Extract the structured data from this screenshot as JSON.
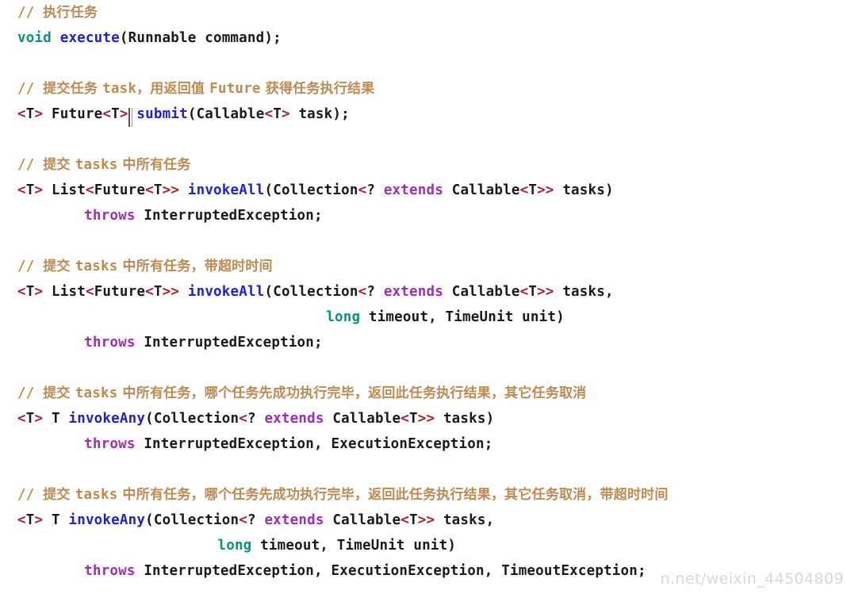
{
  "editor": {
    "background": "#ffffff",
    "language": "java",
    "colors": {
      "comment": "#bd8a54",
      "keyword": "#0f9177",
      "method": "#2222cc",
      "modifier": "#9b2fb4",
      "generic_bracket": "#a5212b",
      "plain_text": "#1a1a1a",
      "watermark": "#d8d8d8"
    }
  },
  "watermark": {
    "text": "n.net/weixin_44504809"
  },
  "code": {
    "lines": [
      {
        "id": "line-1-comment-execute",
        "indent": 0,
        "tokens": [
          {
            "kind": "comment",
            "text": "// "
          },
          {
            "kind": "comment",
            "cjk": true,
            "text": "执行任务"
          }
        ]
      },
      {
        "id": "line-2-execute-signature",
        "indent": 0,
        "tokens": [
          {
            "kind": "keyword",
            "text": "void"
          },
          {
            "kind": "plain",
            "text": " "
          },
          {
            "kind": "method",
            "text": "execute"
          },
          {
            "kind": "plain",
            "text": "(Runnable command);"
          }
        ]
      },
      {
        "id": "line-3-blank",
        "blank": true,
        "tokens": []
      },
      {
        "id": "line-4-comment-submit",
        "indent": 0,
        "tokens": [
          {
            "kind": "comment",
            "text": "// "
          },
          {
            "kind": "comment",
            "cjk": true,
            "text": "提交任务 "
          },
          {
            "kind": "comment",
            "text": "task"
          },
          {
            "kind": "comment",
            "cjk": true,
            "text": "，用返回值 "
          },
          {
            "kind": "comment",
            "text": "Future"
          },
          {
            "kind": "comment",
            "cjk": true,
            "text": " 获得任务执行结果"
          }
        ]
      },
      {
        "id": "line-5-submit-signature",
        "indent": 0,
        "tokens": [
          {
            "kind": "generic",
            "text": "<"
          },
          {
            "kind": "plain",
            "text": "T"
          },
          {
            "kind": "generic",
            "text": ">"
          },
          {
            "kind": "plain",
            "text": " Future"
          },
          {
            "kind": "generic",
            "text": "<"
          },
          {
            "kind": "plain",
            "text": "T"
          },
          {
            "kind": "generic",
            "text": ">"
          },
          {
            "kind": "caret",
            "text": ""
          },
          {
            "kind": "plain",
            "text": " "
          },
          {
            "kind": "method",
            "text": "submit"
          },
          {
            "kind": "plain",
            "text": "(Callable"
          },
          {
            "kind": "generic",
            "text": "<"
          },
          {
            "kind": "plain",
            "text": "T"
          },
          {
            "kind": "generic",
            "text": ">"
          },
          {
            "kind": "plain",
            "text": " task);"
          }
        ]
      },
      {
        "id": "line-6-blank",
        "blank": true,
        "tokens": []
      },
      {
        "id": "line-7-comment-invokeall",
        "indent": 0,
        "tokens": [
          {
            "kind": "comment",
            "text": "// "
          },
          {
            "kind": "comment",
            "cjk": true,
            "text": "提交 "
          },
          {
            "kind": "comment",
            "text": "tasks"
          },
          {
            "kind": "comment",
            "cjk": true,
            "text": " 中所有任务"
          }
        ]
      },
      {
        "id": "line-8-invokeall-signature",
        "indent": 0,
        "tokens": [
          {
            "kind": "generic",
            "text": "<"
          },
          {
            "kind": "plain",
            "text": "T"
          },
          {
            "kind": "generic",
            "text": ">"
          },
          {
            "kind": "plain",
            "text": " List"
          },
          {
            "kind": "generic",
            "text": "<"
          },
          {
            "kind": "plain",
            "text": "Future"
          },
          {
            "kind": "generic",
            "text": "<"
          },
          {
            "kind": "plain",
            "text": "T"
          },
          {
            "kind": "generic",
            "text": ">>"
          },
          {
            "kind": "plain",
            "text": " "
          },
          {
            "kind": "method",
            "text": "invokeAll"
          },
          {
            "kind": "plain",
            "text": "(Collection"
          },
          {
            "kind": "generic",
            "text": "<"
          },
          {
            "kind": "plain",
            "text": "? "
          },
          {
            "kind": "modifier",
            "text": "extends"
          },
          {
            "kind": "plain",
            "text": " Callable"
          },
          {
            "kind": "generic",
            "text": "<"
          },
          {
            "kind": "plain",
            "text": "T"
          },
          {
            "kind": "generic",
            "text": ">>"
          },
          {
            "kind": "plain",
            "text": " tasks)"
          }
        ]
      },
      {
        "id": "line-9-invokeall-throws",
        "indent": 8,
        "tokens": [
          {
            "kind": "modifier",
            "text": "throws"
          },
          {
            "kind": "plain",
            "text": " InterruptedException;"
          }
        ]
      },
      {
        "id": "line-10-blank",
        "blank": true,
        "tokens": []
      },
      {
        "id": "line-11-comment-invokeall-timeout",
        "indent": 0,
        "tokens": [
          {
            "kind": "comment",
            "text": "// "
          },
          {
            "kind": "comment",
            "cjk": true,
            "text": "提交 "
          },
          {
            "kind": "comment",
            "text": "tasks"
          },
          {
            "kind": "comment",
            "cjk": true,
            "text": " 中所有任务，带超时时间"
          }
        ]
      },
      {
        "id": "line-12-invokeall-timeout-signature",
        "indent": 0,
        "tokens": [
          {
            "kind": "generic",
            "text": "<"
          },
          {
            "kind": "plain",
            "text": "T"
          },
          {
            "kind": "generic",
            "text": ">"
          },
          {
            "kind": "plain",
            "text": " List"
          },
          {
            "kind": "generic",
            "text": "<"
          },
          {
            "kind": "plain",
            "text": "Future"
          },
          {
            "kind": "generic",
            "text": "<"
          },
          {
            "kind": "plain",
            "text": "T"
          },
          {
            "kind": "generic",
            "text": ">>"
          },
          {
            "kind": "plain",
            "text": " "
          },
          {
            "kind": "method",
            "text": "invokeAll"
          },
          {
            "kind": "plain",
            "text": "(Collection"
          },
          {
            "kind": "generic",
            "text": "<"
          },
          {
            "kind": "plain",
            "text": "? "
          },
          {
            "kind": "modifier",
            "text": "extends"
          },
          {
            "kind": "plain",
            "text": " Callable"
          },
          {
            "kind": "generic",
            "text": "<"
          },
          {
            "kind": "plain",
            "text": "T"
          },
          {
            "kind": "generic",
            "text": ">>"
          },
          {
            "kind": "plain",
            "text": " tasks,"
          }
        ]
      },
      {
        "id": "line-13-invokeall-timeout-params",
        "indent": 37,
        "tokens": [
          {
            "kind": "keyword",
            "text": "long"
          },
          {
            "kind": "plain",
            "text": " timeout, TimeUnit unit)"
          }
        ]
      },
      {
        "id": "line-14-invokeall-timeout-throws",
        "indent": 8,
        "tokens": [
          {
            "kind": "modifier",
            "text": "throws"
          },
          {
            "kind": "plain",
            "text": " InterruptedException;"
          }
        ]
      },
      {
        "id": "line-15-blank",
        "blank": true,
        "tokens": []
      },
      {
        "id": "line-16-comment-invokeany",
        "indent": 0,
        "tokens": [
          {
            "kind": "comment",
            "text": "// "
          },
          {
            "kind": "comment",
            "cjk": true,
            "text": "提交 "
          },
          {
            "kind": "comment",
            "text": "tasks"
          },
          {
            "kind": "comment",
            "cjk": true,
            "text": " 中所有任务，哪个任务先成功执行完毕，返回此任务执行结果，其它任务取消"
          }
        ]
      },
      {
        "id": "line-17-invokeany-signature",
        "indent": 0,
        "tokens": [
          {
            "kind": "generic",
            "text": "<"
          },
          {
            "kind": "plain",
            "text": "T"
          },
          {
            "kind": "generic",
            "text": ">"
          },
          {
            "kind": "plain",
            "text": " T "
          },
          {
            "kind": "method",
            "text": "invokeAny"
          },
          {
            "kind": "plain",
            "text": "(Collection"
          },
          {
            "kind": "generic",
            "text": "<"
          },
          {
            "kind": "plain",
            "text": "? "
          },
          {
            "kind": "modifier",
            "text": "extends"
          },
          {
            "kind": "plain",
            "text": " Callable"
          },
          {
            "kind": "generic",
            "text": "<"
          },
          {
            "kind": "plain",
            "text": "T"
          },
          {
            "kind": "generic",
            "text": ">>"
          },
          {
            "kind": "plain",
            "text": " tasks)"
          }
        ]
      },
      {
        "id": "line-18-invokeany-throws",
        "indent": 8,
        "tokens": [
          {
            "kind": "modifier",
            "text": "throws"
          },
          {
            "kind": "plain",
            "text": " InterruptedException, ExecutionException;"
          }
        ]
      },
      {
        "id": "line-19-blank",
        "blank": true,
        "tokens": []
      },
      {
        "id": "line-20-comment-invokeany-timeout",
        "indent": 0,
        "tokens": [
          {
            "kind": "comment",
            "text": "// "
          },
          {
            "kind": "comment",
            "cjk": true,
            "text": "提交 "
          },
          {
            "kind": "comment",
            "text": "tasks"
          },
          {
            "kind": "comment",
            "cjk": true,
            "text": " 中所有任务，哪个任务先成功执行完毕，返回此任务执行结果，其它任务取消，带超时时间"
          }
        ]
      },
      {
        "id": "line-21-invokeany-timeout-signature",
        "indent": 0,
        "tokens": [
          {
            "kind": "generic",
            "text": "<"
          },
          {
            "kind": "plain",
            "text": "T"
          },
          {
            "kind": "generic",
            "text": ">"
          },
          {
            "kind": "plain",
            "text": " T "
          },
          {
            "kind": "method",
            "text": "invokeAny"
          },
          {
            "kind": "plain",
            "text": "(Collection"
          },
          {
            "kind": "generic",
            "text": "<"
          },
          {
            "kind": "plain",
            "text": "? "
          },
          {
            "kind": "modifier",
            "text": "extends"
          },
          {
            "kind": "plain",
            "text": " Callable"
          },
          {
            "kind": "generic",
            "text": "<"
          },
          {
            "kind": "plain",
            "text": "T"
          },
          {
            "kind": "generic",
            "text": ">>"
          },
          {
            "kind": "plain",
            "text": " tasks,"
          }
        ]
      },
      {
        "id": "line-22-invokeany-timeout-params",
        "indent": 24,
        "tokens": [
          {
            "kind": "keyword",
            "text": "long"
          },
          {
            "kind": "plain",
            "text": " timeout, TimeUnit unit)"
          }
        ]
      },
      {
        "id": "line-23-invokeany-timeout-throws",
        "indent": 8,
        "tokens": [
          {
            "kind": "modifier",
            "text": "throws"
          },
          {
            "kind": "plain",
            "text": " InterruptedException, ExecutionException, TimeoutException;"
          }
        ]
      }
    ]
  }
}
